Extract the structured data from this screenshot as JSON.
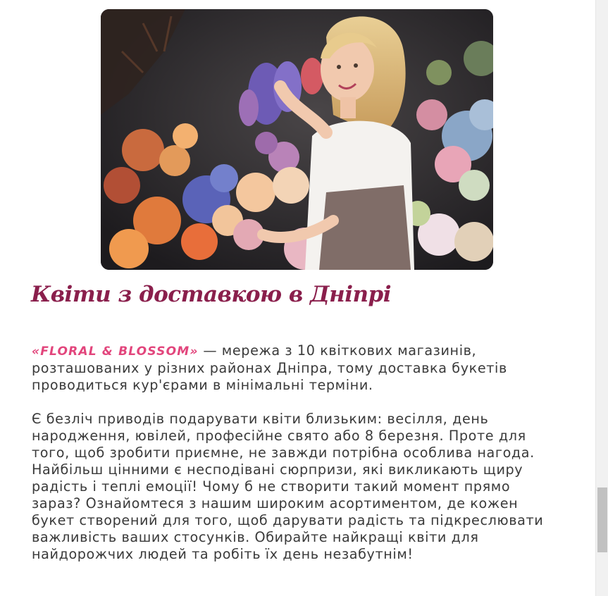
{
  "hero_image": {
    "alt": "",
    "subject": "florist-woman-with-flowers"
  },
  "heading": "Квіти з доставкою в Дніпрі",
  "intro": {
    "brand": "«FLORAL & BLOSSOM»",
    "text": " — мережа з 10 квіткових магазинів, розташованих у різних районах Дніпра, тому доставка букетів проводиться кур'єрами в мінімальні терміни."
  },
  "body_paragraph": "Є безліч приводів подарувати квіти близьким: весілля, день народження, ювілей, професійне свято або 8 березня. Проте для того, щоб зробити приємне, не завжди потрібна особлива нагода. Найбільш цінними є несподівані сюрпризи, які викликають щиру радість і теплі емоції! Чому б не створити такий момент прямо зараз? Ознайомтеся з нашим широким асортиментом, де кожен букет створений для того, щоб дарувати радість та підкреслювати важливість ваших стосунків. Обирайте найкращі квіти для найдорожчих людей та робіть їх день незабутнім!",
  "colors": {
    "heading": "#8a1f4c",
    "brand": "#e2457c",
    "text": "#3a3a3a"
  }
}
